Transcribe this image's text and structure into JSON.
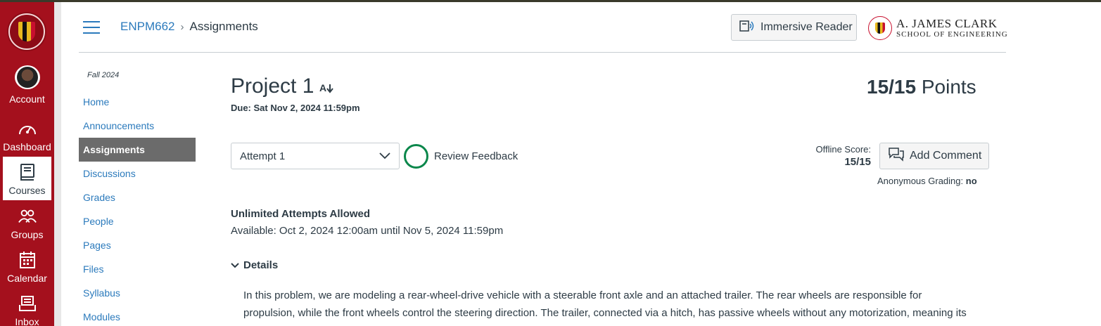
{
  "global_nav": {
    "items": [
      {
        "label": "Account",
        "icon": "user-avatar"
      },
      {
        "label": "Dashboard",
        "icon": "dashboard-gauge-icon"
      },
      {
        "label": "Courses",
        "icon": "courses-book-icon"
      },
      {
        "label": "Groups",
        "icon": "groups-people-icon"
      },
      {
        "label": "Calendar",
        "icon": "calendar-icon"
      },
      {
        "label": "Inbox",
        "icon": "inbox-icon"
      }
    ],
    "active": "Courses",
    "accent": "#a4101d"
  },
  "header": {
    "breadcrumb": {
      "course": "ENPM662",
      "separator": "›",
      "current": "Assignments"
    },
    "immersive_reader_label": "Immersive Reader",
    "brand": {
      "line1": "A. JAMES CLARK",
      "line2": "SCHOOL OF ENGINEERING"
    }
  },
  "course_nav": {
    "term": "Fall 2024",
    "items": [
      "Home",
      "Announcements",
      "Assignments",
      "Discussions",
      "Grades",
      "People",
      "Pages",
      "Files",
      "Syllabus",
      "Modules"
    ],
    "active": "Assignments"
  },
  "assignment": {
    "title": "Project 1",
    "due": "Due: Sat Nov 2, 2024 11:59pm",
    "points_score": "15/15",
    "points_label": "Points",
    "attempt_select": "Attempt 1",
    "review_feedback": "Review Feedback",
    "offline_score_label": "Offline Score:",
    "offline_score_value": "15/15",
    "add_comment_label": "Add Comment",
    "anonymous_grading_label": "Anonymous Grading:",
    "anonymous_grading_value": "no",
    "attempts_allowed": "Unlimited Attempts Allowed",
    "available": "Available: Oct 2, 2024 12:00am until Nov 5, 2024 11:59pm",
    "details_label": "Details",
    "description": "In this problem, we are modeling a rear-wheel-drive vehicle with a steerable front axle and an attached trailer. The rear wheels are responsible for propulsion, while the front wheels control the steering direction. The trailer, connected via a hitch, has passive wheels without any motorization, meaning its motion is purely dependent on the pulling force of the"
  }
}
